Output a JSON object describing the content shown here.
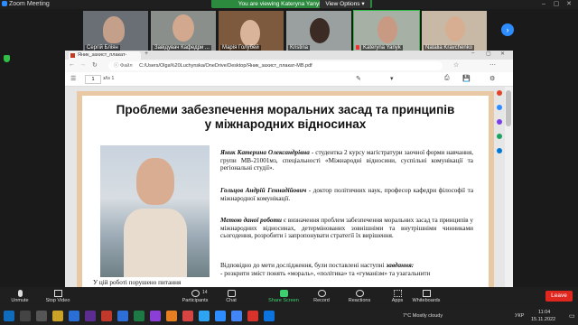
{
  "app": {
    "title": "Zoom Meeting"
  },
  "banner": {
    "text": "You are viewing Kateryna Yanyk's screen",
    "view_options": "View Options"
  },
  "participants": [
    {
      "name": "Сергій Бліян"
    },
    {
      "name": "Завідувач Кафедри ..."
    },
    {
      "name": "Марія Голубей"
    },
    {
      "name": "Kristina"
    },
    {
      "name": "Kateryna Yanyk"
    },
    {
      "name": "Natalia Kravchenko"
    }
  ],
  "browser": {
    "tab_title": "Яник_захист_плакат-МВ.pdf",
    "address_prefix": "Файл",
    "address": "C:/Users/Olga%20Luchynska/OneDrive/Desktop/Яник_захист_плакат-МВ.pdf",
    "page_current": "1",
    "page_total": "з/із 1"
  },
  "document": {
    "title_line1": "Проблеми забезпечення  моральних засад та принципів",
    "title_line2": "у міжнародних відносинах",
    "author_name": "Яник Катерина Олександрівна",
    "author_text": " - студентка 2 курсу магістратури заочної форми навчання, групи МВ-21001мз, спеціальності «Міжнародні відносини, суспільні комунікації та регіональні студії».",
    "supervisor_name": "Гольцов Андрій Геннадійович",
    "supervisor_text": " - доктор політичних наук, професор кафедри філософії та міжнародної комунікації.",
    "goal_label": "Метою даної роботи",
    "goal_text": " є визначення проблем забезпечення моральних засад та принципів у міжнародних відносинах, детермінованих зовнішніми та внутрішніми чинниками сьогодення, розробити і запропонувати стратегії їх вирішення.",
    "tasks_text": "Відповідно до мети дослідження, були поставлені наступні ",
    "tasks_label": "завдання:",
    "tasks_item": "- розкрити зміст понять «мораль», «політика» та «гуманізм» та узагальнити",
    "left_caption": "У цій роботі порушено питання"
  },
  "toolbar": {
    "items": [
      {
        "label": "Unmute"
      },
      {
        "label": "Stop Video"
      },
      {
        "label": "Participants",
        "count": "14"
      },
      {
        "label": "Chat"
      },
      {
        "label": "Share Screen"
      },
      {
        "label": "Record"
      },
      {
        "label": "Reactions"
      },
      {
        "label": "Apps"
      },
      {
        "label": "Whiteboards"
      }
    ],
    "leave": "Leave"
  },
  "taskbar": {
    "weather": "7°C  Mostly cloudy",
    "lang": "УКР",
    "time": "11:04",
    "date": "15.11.2022"
  },
  "colors": {
    "share_banner": "#2b8a3e",
    "leave": "#e0271f",
    "page_border": "#e9c9a3",
    "zoom_blue": "#2d8cff"
  }
}
